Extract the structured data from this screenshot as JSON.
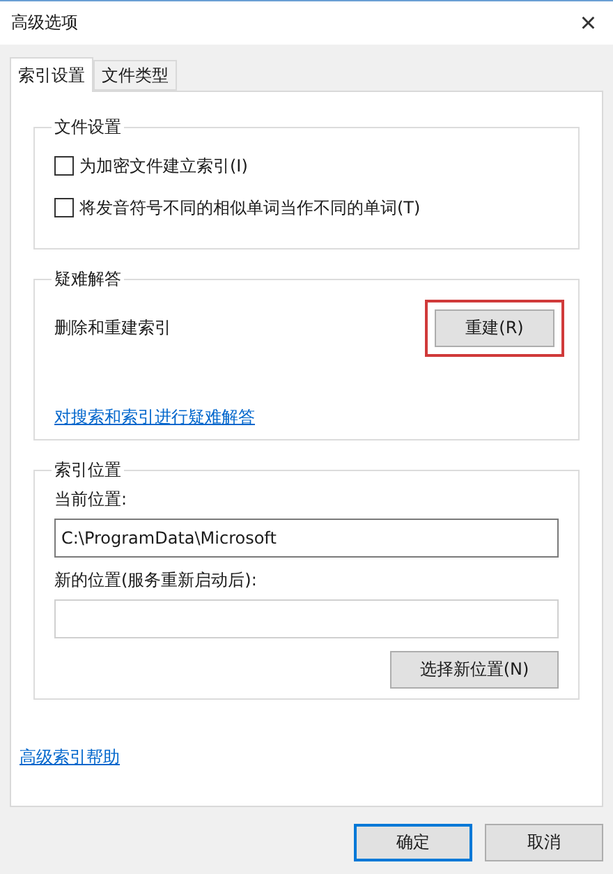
{
  "window": {
    "title": "高级选项",
    "close": "×"
  },
  "tabs": [
    {
      "label": "索引设置",
      "selected": true
    },
    {
      "label": "文件类型",
      "selected": false
    }
  ],
  "file_settings": {
    "title": "文件设置",
    "options": [
      {
        "label": "为加密文件建立索引(I)",
        "checked": false
      },
      {
        "label": "将发音符号不同的相似单词当作不同的单词(T)",
        "checked": false
      }
    ]
  },
  "troubleshooting": {
    "title": "疑难解答",
    "description": "删除和重建索引",
    "button": {
      "label": "重建(R)",
      "highlighted": true
    },
    "link": "对搜索和索引进行疑难解答"
  },
  "index_location": {
    "title": "索引位置",
    "current_label": "当前位置:",
    "current_value": "C:\\ProgramData\\Microsoft",
    "new_label": "新的位置(服务重新启动后):",
    "button": "选择新位置(N)"
  },
  "help_link": "高级索引帮助",
  "buttons": [
    {
      "label": "确定",
      "default": true
    },
    {
      "label": "取消",
      "default": false
    }
  ]
}
